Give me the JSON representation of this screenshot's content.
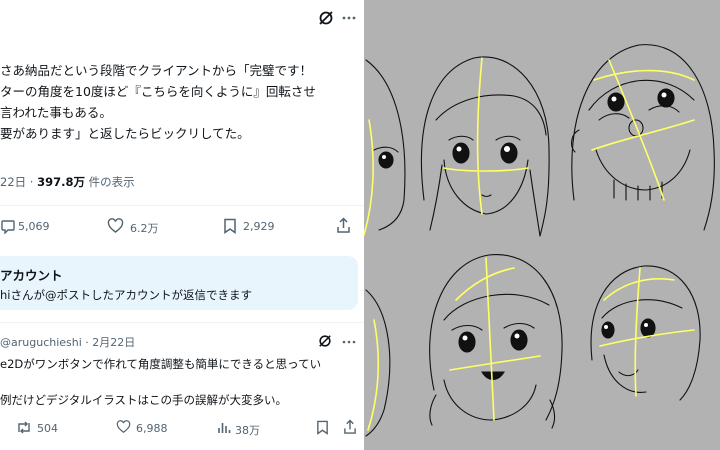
{
  "post": {
    "body_lines": [
      "さあ納品だという段階でクライアントから「完璧です！",
      "ターの角度を10度ほど『こちらを向くように』回転させ",
      "言われた事もある。",
      "要があります」と返したらビックリしてた。"
    ],
    "date_prefix": "22日 · ",
    "views_number": "397.8万",
    "views_suffix": " 件の表示",
    "actions": {
      "replies": "5,069",
      "likes": "6.2万",
      "bookmarks": "2,929"
    }
  },
  "reply_notice": {
    "title": "アカウント",
    "text": "hiさんが@ポストしたアカウントが返信できます"
  },
  "reply": {
    "header": "@aruguchieshi · 2月22日",
    "line1": "e2Dがワンボタンで作れて角度調整も簡単にできると思ってい",
    "line2": "例だけどデジタルイラストはこの手の誤解が大変多い。",
    "actions": {
      "reposts": "504",
      "likes": "6,988",
      "views": "38万"
    }
  },
  "colors": {
    "text": "#0f1419",
    "secondary": "#536471",
    "notice_bg": "#e8f5fd",
    "illustration_bg": "#b2b2b2",
    "guide_line": "#ffff66"
  },
  "icons": [
    "grok-icon",
    "more-icon",
    "reply-icon",
    "like-icon",
    "bookmark-icon",
    "share-icon",
    "repost-icon",
    "views-icon"
  ]
}
